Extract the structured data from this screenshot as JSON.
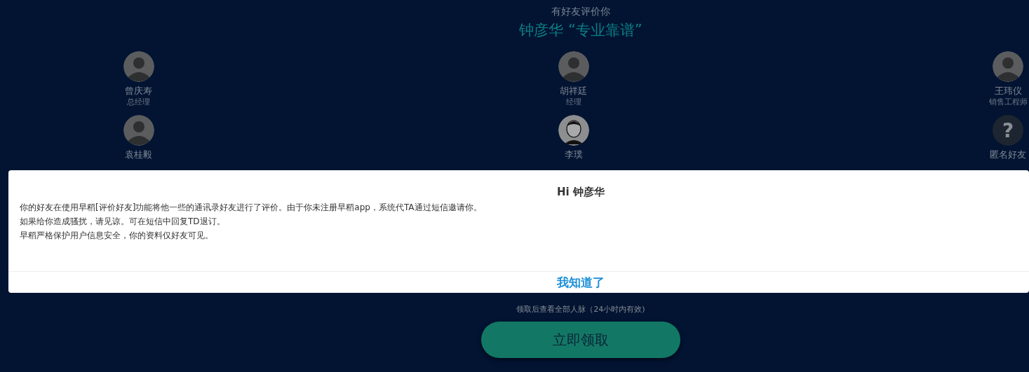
{
  "header": {
    "subtitle": "有好友评价你",
    "headline": "钟彦华 “专业靠谱”"
  },
  "friend_rows": [
    [
      {
        "kind": "photo",
        "name": "曾庆寿",
        "title": "总经理"
      },
      {
        "kind": "photo",
        "name": "胡祥廷",
        "title": "经理"
      },
      {
        "kind": "photo",
        "name": "王玮仪",
        "title": "销售工程师"
      }
    ],
    [
      {
        "kind": "photo",
        "name": "袁桂毅"
      },
      {
        "kind": "cartoon",
        "name": "李璞"
      },
      {
        "kind": "anonymous",
        "glyph": "?",
        "name": "匿名好友"
      }
    ]
  ],
  "claim_note": "领取后查看全部人脉（24小时内有效)",
  "claim_button": "立即领取",
  "dialog": {
    "title": "Hi 钟彦华",
    "lines": [
      "你的好友在使用早稻[评价好友]功能将他一些的通讯录好友进行了评价。由于你未注册早稻app，系统代TA通过短信邀请你。",
      "如果给你造成骚扰，请见谅。可在短信中回复TD退订。",
      "早稻严格保护用户信息安全，你的资料仅好友可见。"
    ],
    "button": "我知道了"
  }
}
